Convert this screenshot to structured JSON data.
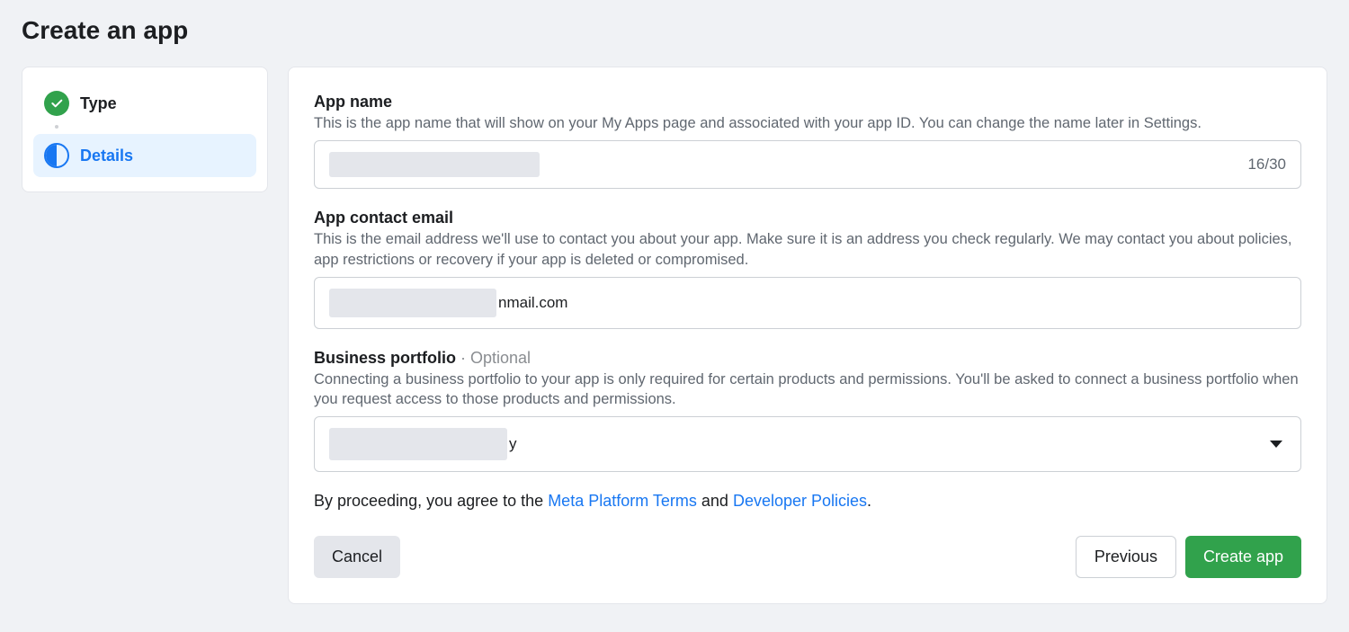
{
  "page": {
    "title": "Create an app"
  },
  "sidebar": {
    "steps": [
      {
        "label": "Type",
        "state": "done"
      },
      {
        "label": "Details",
        "state": "active"
      }
    ]
  },
  "form": {
    "app_name": {
      "label": "App name",
      "desc": "This is the app name that will show on your My Apps page and associated with your app ID. You can change the name later in Settings.",
      "value_redacted": true,
      "counter": "16/30"
    },
    "contact_email": {
      "label": "App contact email",
      "desc": "This is the email address we'll use to contact you about your app. Make sure it is an address you check regularly. We may contact you about policies, app restrictions or recovery if your app is deleted or compromised.",
      "value_redacted_prefix": true,
      "value_visible_suffix": "nmail.com"
    },
    "business_portfolio": {
      "label": "Business portfolio",
      "optional_label": " · Optional",
      "desc": "Connecting a business portfolio to your app is only required for certain products and permissions. You'll be asked to connect a business portfolio when you request access to those products and permissions.",
      "value_redacted_prefix": true,
      "value_visible_suffix": "y"
    }
  },
  "legal": {
    "prefix": "By proceeding, you agree to the ",
    "link1": "Meta Platform Terms",
    "mid": " and ",
    "link2": "Developer Policies",
    "suffix": "."
  },
  "buttons": {
    "cancel": "Cancel",
    "previous": "Previous",
    "create": "Create app"
  }
}
